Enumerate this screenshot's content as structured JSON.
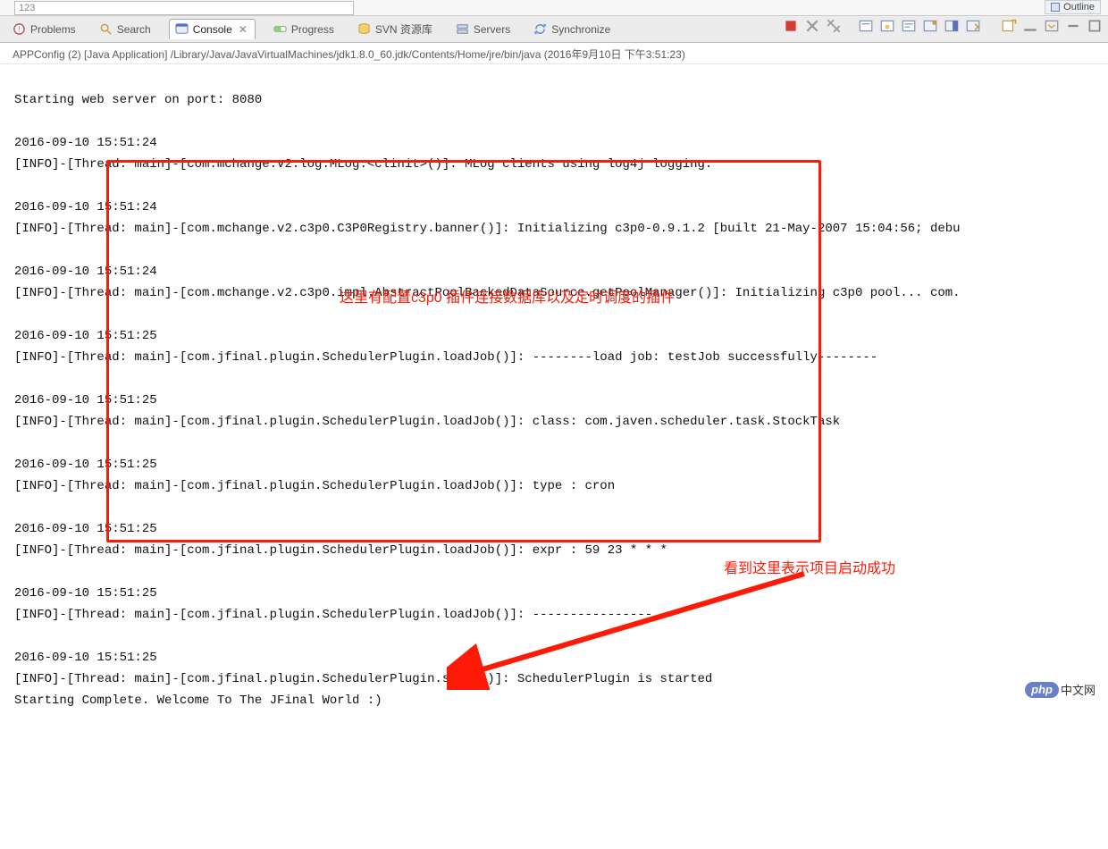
{
  "top": {
    "input_value": "123",
    "outline_label": "Outline"
  },
  "views": {
    "problems": "Problems",
    "search": "Search",
    "console": "Console",
    "progress": "Progress",
    "svn": "SVN 资源库",
    "servers": "Servers",
    "synchronize": "Synchronize"
  },
  "launch": {
    "text": "APPConfig (2) [Java Application] /Library/Java/JavaVirtualMachines/jdk1.8.0_60.jdk/Contents/Home/jre/bin/java (2016年9月10日 下午3:51:23)"
  },
  "console": {
    "lines": "Starting web server on port: 8080\n\n2016-09-10 15:51:24\n[INFO]-[Thread: main]-[com.mchange.v2.log.MLog.<clinit>()]: MLog clients using log4j logging.\n\n2016-09-10 15:51:24\n[INFO]-[Thread: main]-[com.mchange.v2.c3p0.C3P0Registry.banner()]: Initializing c3p0-0.9.1.2 [built 21-May-2007 15:04:56; debu\n\n2016-09-10 15:51:24\n[INFO]-[Thread: main]-[com.mchange.v2.c3p0.impl.AbstractPoolBackedDataSource.getPoolManager()]: Initializing c3p0 pool... com.\n\n2016-09-10 15:51:25\n[INFO]-[Thread: main]-[com.jfinal.plugin.SchedulerPlugin.loadJob()]: --------load job: testJob successfully--------\n\n2016-09-10 15:51:25\n[INFO]-[Thread: main]-[com.jfinal.plugin.SchedulerPlugin.loadJob()]: class: com.javen.scheduler.task.StockTask\n\n2016-09-10 15:51:25\n[INFO]-[Thread: main]-[com.jfinal.plugin.SchedulerPlugin.loadJob()]: type : cron\n\n2016-09-10 15:51:25\n[INFO]-[Thread: main]-[com.jfinal.plugin.SchedulerPlugin.loadJob()]: expr : 59 23 * * *\n\n2016-09-10 15:51:25\n[INFO]-[Thread: main]-[com.jfinal.plugin.SchedulerPlugin.loadJob()]: ----------------\n\n2016-09-10 15:51:25\n[INFO]-[Thread: main]-[com.jfinal.plugin.SchedulerPlugin.start()]: SchedulerPlugin is started\nStarting Complete. Welcome To The JFinal World :)"
  },
  "annotations": {
    "a1": "这里有配置c3p0 插件连接数据库以及定时调度的插件",
    "a2": "看到这里表示项目启动成功"
  },
  "brand": {
    "pill": "php",
    "suffix": "中文网"
  }
}
